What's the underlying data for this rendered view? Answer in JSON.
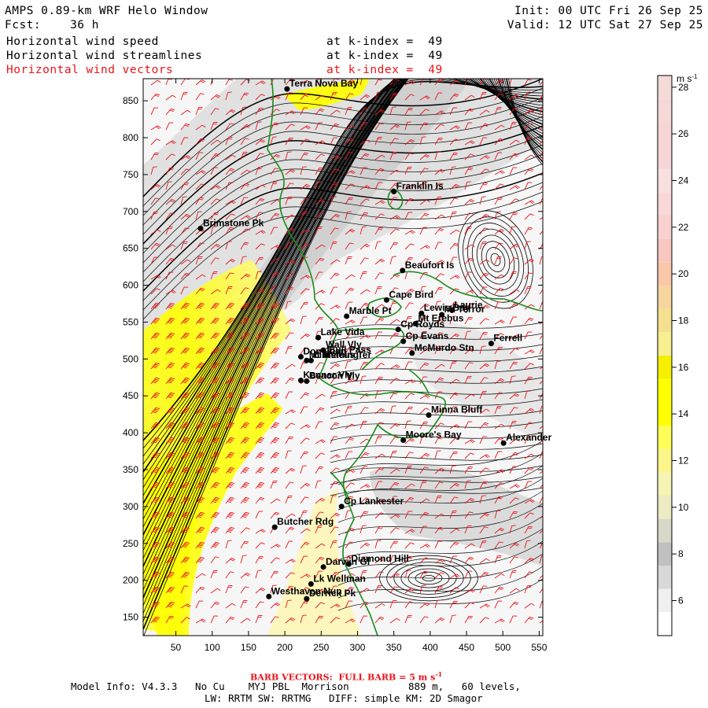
{
  "header": {
    "title": "AMPS 0.89-km WRF Helo Window",
    "fcst_label": "Fcst:",
    "fcst_value": "36 h",
    "init": "Init: 00 UTC Fri 26 Sep 25",
    "valid": "Valid: 12 UTC Sat 27 Sep 25",
    "fields": [
      {
        "name": "Horizontal wind speed",
        "level": "at k-index =  49",
        "color": "#000000"
      },
      {
        "name": "Horizontal wind streamlines",
        "level": "at k-index =  49",
        "color": "#000000"
      },
      {
        "name": "Horizontal wind vectors",
        "level": "at k-index =  49",
        "color": "#e8141a"
      }
    ]
  },
  "axes": {
    "x_ticks": [
      50,
      100,
      150,
      200,
      250,
      300,
      350,
      400,
      450,
      500,
      550
    ],
    "y_ticks": [
      150,
      200,
      250,
      300,
      350,
      400,
      450,
      500,
      550,
      600,
      650,
      700,
      750,
      800,
      850
    ],
    "x_range": [
      5,
      555
    ],
    "y_range": [
      125,
      880
    ]
  },
  "colorbar": {
    "unit": "m s",
    "unit_exp": "-1",
    "levels": [
      6,
      8,
      10,
      12,
      14,
      16,
      18,
      20,
      22,
      24,
      26,
      28
    ],
    "colors": [
      "#ffffff",
      "#f0f0f0",
      "#d8d8d8",
      "#c0c0c0",
      "#d8d8c8",
      "#ecebc4",
      "#f6f4b4",
      "#fbf58a",
      "#ffff57",
      "#ffff00",
      "#ffff00",
      "#f5f000",
      "#f7f090",
      "#f5e090",
      "#f6d5a0",
      "#f8c8a8",
      "#f8c8c0",
      "#f8d0d0",
      "#f8d8d8",
      "#f8e0e0",
      "#f5d5d5",
      "#f5d5d5",
      "#f5d8d8",
      "#f5dada"
    ]
  },
  "places": [
    {
      "name": "Terra Nova Bay",
      "x": 203,
      "y": 866
    },
    {
      "name": "Franklin Is",
      "x": 350,
      "y": 727
    },
    {
      "name": "Brimstone Pk",
      "x": 84,
      "y": 677
    },
    {
      "name": "Beaufort Is",
      "x": 362,
      "y": 620
    },
    {
      "name": "Cape Bird",
      "x": 340,
      "y": 580
    },
    {
      "name": "Lewis Bay",
      "x": 388,
      "y": 562
    },
    {
      "name": "Laurie",
      "x": 430,
      "y": 566
    },
    {
      "name": "Mt Terror",
      "x": 416,
      "y": 560
    },
    {
      "name": "Marble Pt",
      "x": 285,
      "y": 558
    },
    {
      "name": "Cp Royds",
      "x": 356,
      "y": 540
    },
    {
      "name": "Mt Erebus",
      "x": 380,
      "y": 548
    },
    {
      "name": "Ferrell",
      "x": 484,
      "y": 521
    },
    {
      "name": "Cp Evans",
      "x": 363,
      "y": 524
    },
    {
      "name": "Lake Vida",
      "x": 246,
      "y": 529
    },
    {
      "name": "Wall Vly",
      "x": 253,
      "y": 512
    },
    {
      "name": "McMurdo Stn",
      "x": 375,
      "y": 508
    },
    {
      "name": "Bull Pass",
      "x": 257,
      "y": 505
    },
    {
      "name": "Don Juan",
      "x": 222,
      "y": 503
    },
    {
      "name": "Mt Fleming",
      "x": 230,
      "y": 498
    },
    {
      "name": "Linnaeus Ter",
      "x": 236,
      "y": 498
    },
    {
      "name": "Kennar Vly",
      "x": 222,
      "y": 471
    },
    {
      "name": "Beacon Vly",
      "x": 230,
      "y": 470
    },
    {
      "name": "Minna Bluff",
      "x": 398,
      "y": 424
    },
    {
      "name": "Moore's Bay",
      "x": 363,
      "y": 390
    },
    {
      "name": "Alexander",
      "x": 501,
      "y": 386
    },
    {
      "name": "Cp Lankester",
      "x": 278,
      "y": 300
    },
    {
      "name": "Butcher Rdg",
      "x": 186,
      "y": 272
    },
    {
      "name": "Darwin Gl",
      "x": 253,
      "y": 218
    },
    {
      "name": "Diamond Hill",
      "x": 288,
      "y": 222
    },
    {
      "name": "Lk Wellman",
      "x": 236,
      "y": 195
    },
    {
      "name": "Westhaven Nun",
      "x": 178,
      "y": 178
    },
    {
      "name": "Derrick Pk",
      "x": 230,
      "y": 175
    }
  ],
  "footer": {
    "barb_note": "BARB VECTORS:  FULL BARB = 5 m s",
    "barb_exp": "-1",
    "model_info_line1": "Model Info: V4.3.3   No Cu    MYJ PBL  Morrison          889 m,   60 levels,",
    "model_info_line2": "LW: RRTM SW: RRTMG   DIFF: simple KM: 2D Smagor"
  }
}
